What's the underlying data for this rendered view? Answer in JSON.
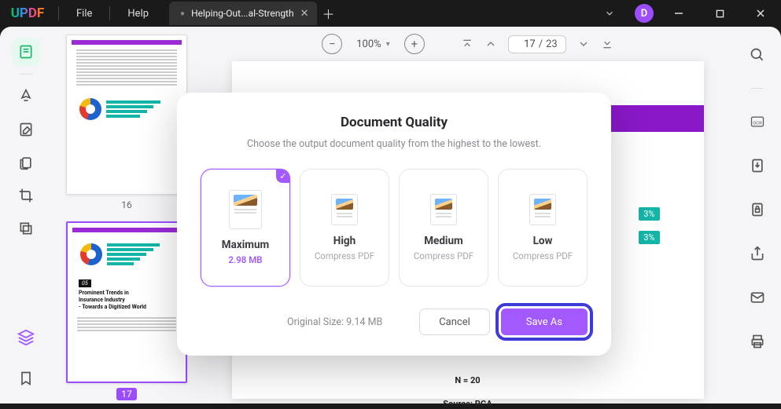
{
  "titlebar": {
    "logo": "UPDF",
    "file_label": "File",
    "help_label": "Help",
    "tab_title": "Helping-Out...al-Strength",
    "avatar_letter": "D"
  },
  "toolbar": {
    "zoom_text": "100%",
    "page_current": "17",
    "page_total": "23"
  },
  "thumbs": {
    "page16_label": "16",
    "page17_label": "17"
  },
  "page_content": {
    "badge1_text": "3%",
    "badge2_text": "3%",
    "n20": "N = 20",
    "source": "Source: RGA"
  },
  "page17_thumb": {
    "section_num": "05",
    "heading_l1": "Prominent Trends in",
    "heading_l2": "Insurance Industry",
    "heading_l3": "- Towards a Digitized World"
  },
  "modal": {
    "title": "Document Quality",
    "subtitle": "Choose the output document quality from the highest to the lowest.",
    "options": {
      "max_name": "Maximum",
      "max_sub": "2.98 MB",
      "high_name": "High",
      "high_sub": "Compress PDF",
      "med_name": "Medium",
      "med_sub": "Compress PDF",
      "low_name": "Low",
      "low_sub": "Compress PDF"
    },
    "original_size_label": "Original Size: 9.14 MB",
    "cancel_label": "Cancel",
    "saveas_label": "Save As"
  }
}
